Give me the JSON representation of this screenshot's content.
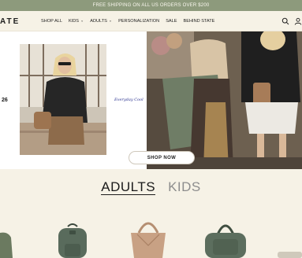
{
  "promo": {
    "text": "FREE SHIPPING ON ALL US ORDERS OVER $200"
  },
  "header": {
    "logo": "ATE",
    "nav": [
      {
        "label": "SHOP ALL",
        "dropdown": false
      },
      {
        "label": "KIDS",
        "dropdown": true
      },
      {
        "label": "ADULTS",
        "dropdown": true
      },
      {
        "label": "PERSONALIZATION",
        "dropdown": false
      },
      {
        "label": "SALE",
        "dropdown": false
      },
      {
        "label": "BEHIND STATE",
        "dropdown": false
      }
    ],
    "icons": [
      "search-icon",
      "account-icon"
    ]
  },
  "hero": {
    "left_number": "26",
    "script_text": "Everyday Cool",
    "cta": "SHOP NOW"
  },
  "collection_tabs": [
    {
      "label": "ADULTS",
      "active": true
    },
    {
      "label": "KIDS",
      "active": false
    }
  ],
  "colors": {
    "promo_bg": "#8d9a7c",
    "page_bg": "#f6f2e6",
    "accent_script": "#29318f"
  }
}
